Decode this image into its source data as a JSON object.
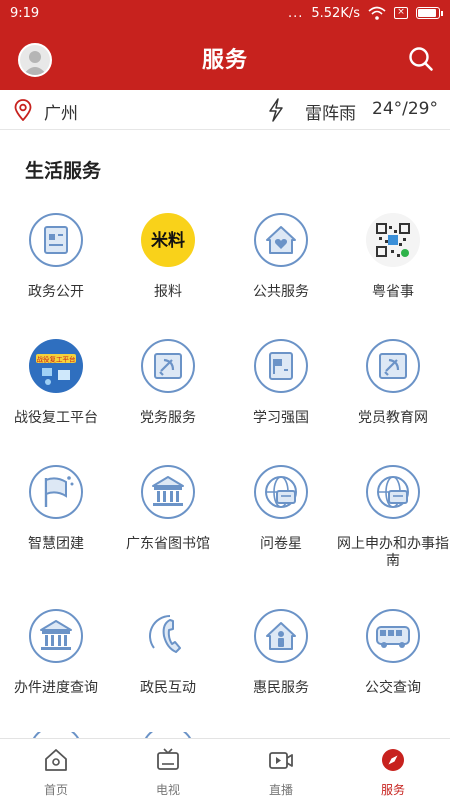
{
  "status_bar": {
    "time": "9:19",
    "dots": "...",
    "network_speed": "5.52K/s"
  },
  "header": {
    "title": "服务"
  },
  "weather": {
    "city": "广州",
    "condition": "雷阵雨",
    "temperature": "24°/29°"
  },
  "section": {
    "title": "生活服务"
  },
  "services": [
    {
      "label": "政务公开",
      "icon": "government-doc-icon"
    },
    {
      "label": "报料",
      "icon": "baoliao-logo-icon"
    },
    {
      "label": "公共服务",
      "icon": "house-heart-icon"
    },
    {
      "label": "粤省事",
      "icon": "qr-code-icon"
    },
    {
      "label": "战役复工平台",
      "icon": "resume-work-platform-icon"
    },
    {
      "label": "党务服务",
      "icon": "party-emblem-icon"
    },
    {
      "label": "学习强国",
      "icon": "party-flag-doc-icon"
    },
    {
      "label": "党员教育网",
      "icon": "party-emblem-icon"
    },
    {
      "label": "智慧团建",
      "icon": "flag-stars-icon"
    },
    {
      "label": "广东省图书馆",
      "icon": "library-building-icon"
    },
    {
      "label": "问卷星",
      "icon": "globe-chat-icon"
    },
    {
      "label": "网上申办和办事指南",
      "icon": "globe-chat-icon"
    },
    {
      "label": "办件进度查询",
      "icon": "institution-building-icon"
    },
    {
      "label": "政民互动",
      "icon": "phone-handset-icon"
    },
    {
      "label": "惠民服务",
      "icon": "person-house-icon"
    },
    {
      "label": "公交查询",
      "icon": "bus-icon"
    }
  ],
  "tabbar": {
    "items": [
      {
        "label": "首页",
        "icon": "home-icon",
        "active": false
      },
      {
        "label": "电视",
        "icon": "tv-icon",
        "active": false
      },
      {
        "label": "直播",
        "icon": "live-video-icon",
        "active": false
      },
      {
        "label": "服务",
        "icon": "compass-icon",
        "active": true
      }
    ]
  },
  "colors": {
    "brand_red": "#c7221e",
    "icon_blue": "#6b93c7",
    "icon_fill": "#dde8f5"
  }
}
